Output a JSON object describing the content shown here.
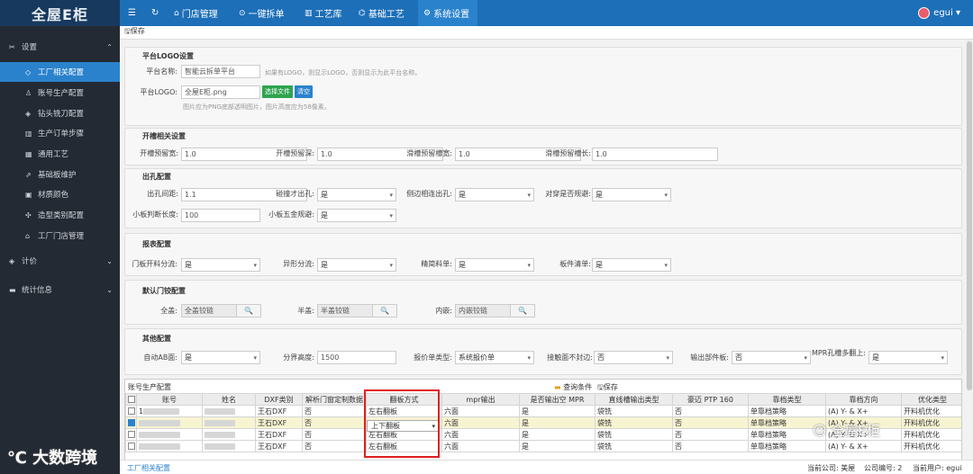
{
  "app": {
    "logo": "全屋E柜"
  },
  "topnav": {
    "items": [
      {
        "label": "门店管理",
        "icon": "⌂"
      },
      {
        "label": "一键拆单",
        "icon": "⊙"
      },
      {
        "label": "工艺库",
        "icon": "▥"
      },
      {
        "label": "基础工艺",
        "icon": "⌬"
      },
      {
        "label": "系统设置",
        "icon": "⚙"
      }
    ],
    "user": "egui ▾"
  },
  "sidebar": {
    "settings": "设置",
    "sub": [
      "工厂相关配置",
      "账号生产配置",
      "钻头铣刀配置",
      "生产订单步骤",
      "通用工艺",
      "基础板维护",
      "材质颜色",
      "造型类别配置",
      "工厂门店管理"
    ],
    "pricing": "计价",
    "stats": "统计信息"
  },
  "toolbar": {
    "save": "保存"
  },
  "logo_section": {
    "title": "平台LOGO设置",
    "name_label": "平台名称:",
    "name_value": "智能云拆单平台",
    "name_hint": "如果有LOGO，则显示LOGO，否则显示为此平台名称。",
    "logo_label": "平台LOGO:",
    "logo_value": "全屋E柜.png",
    "choose_btn": "选择文件",
    "clear_btn": "清空",
    "logo_hint": "图片应为PNG底部透明图片，图片高度应为58像素。"
  },
  "groove": {
    "title": "开槽相关设置",
    "fields": [
      {
        "label": "开槽预留宽:",
        "value": "1.0"
      },
      {
        "label": "开槽预留深:",
        "value": "1.0"
      },
      {
        "label": "滑槽预留槽宽:",
        "value": "1.0"
      },
      {
        "label": "滑槽预留槽长:",
        "value": "1.0"
      }
    ]
  },
  "hole": {
    "title": "出孔配置",
    "spacing_label": "出孔间距:",
    "spacing_value": "1.1",
    "collide_label": "碰撞才出孔:",
    "collide_value": "是",
    "side_label": "侧边相连出孔:",
    "side_value": "是",
    "through_label": "对穿是否规避:",
    "through_value": "是",
    "small_label": "小板判断长度:",
    "small_value": "100",
    "hardware_label": "小板五金规避:",
    "hardware_value": "是"
  },
  "report": {
    "title": "报表配置",
    "fields": [
      {
        "label": "门板开料分流:",
        "value": "是"
      },
      {
        "label": "异形分流:",
        "value": "是"
      },
      {
        "label": "精简料单:",
        "value": "是"
      },
      {
        "label": "板件清单:",
        "value": "是"
      }
    ]
  },
  "door": {
    "title": "默认门铰配置",
    "full_label": "全盖:",
    "full_value": "全盖铰链",
    "half_label": "半盖:",
    "half_value": "半盖铰链",
    "inner_label": "内嵌:",
    "inner_value": "内嵌铰链"
  },
  "other": {
    "title": "其他配置",
    "auto_label": "自动AB面:",
    "auto_value": "是",
    "height_label": "分界高度:",
    "height_value": "1500",
    "quote_label": "报价单类型:",
    "quote_value": "系统报价单",
    "edge_label": "接触面不封边:",
    "edge_value": "否",
    "output_label": "输出部件板:",
    "output_value": "否",
    "mpr_label": "MPR孔槽多翻上:",
    "mpr_value": "是"
  },
  "grid": {
    "title": "账号生产配置",
    "query": "查询条件",
    "save": "保存",
    "columns": [
      "账号",
      "姓名",
      "DXF类别",
      "解析门窗定制数据",
      "翻板方式",
      "mpr输出",
      "是否输出空 MPR",
      "直线槽输出类型",
      "豪迈 PTP 160",
      "靠档类型",
      "靠档方向",
      "优化类型"
    ],
    "rows": [
      {
        "account": "1",
        "dxf": "王石DXF",
        "parse": "否",
        "flip": "左右翻板",
        "mpr": "六面",
        "empty": "是",
        "line": "袋铣",
        "ptp": "否",
        "stop": "单靠档策略",
        "dir": "(A) Y- & X+",
        "opt": "开料机优化",
        "checked": false
      },
      {
        "account": "",
        "dxf": "王石DXF",
        "parse": "否",
        "flip": "",
        "mpr": "六面",
        "empty": "是",
        "line": "袋铣",
        "ptp": "否",
        "stop": "单靠档策略",
        "dir": "(A) Y- & X+",
        "opt": "开料机优化",
        "checked": true
      },
      {
        "account": "",
        "dxf": "王石DXF",
        "parse": "否",
        "flip": "左右翻板",
        "mpr": "六面",
        "empty": "是",
        "line": "袋铣",
        "ptp": "否",
        "stop": "单靠档策略",
        "dir": "(A) Y- & X+",
        "opt": "开料机优化",
        "checked": false
      },
      {
        "account": "",
        "dxf": "王石DXF",
        "parse": "否",
        "flip": "左右翻板",
        "mpr": "六面",
        "empty": "是",
        "line": "袋铣",
        "ptp": "否",
        "stop": "单靠档策略",
        "dir": "(A) Y- & X+",
        "opt": "开料机优化",
        "checked": false
      }
    ],
    "dropdown_value": "上下翻板"
  },
  "status": {
    "tab": "工厂相关配置",
    "company": "当前公司: 美屋",
    "code": "公司编号: 2",
    "user": "当前用户: egui"
  },
  "watermark": {
    "left": "大数跨境",
    "right": "全屋E柜"
  }
}
